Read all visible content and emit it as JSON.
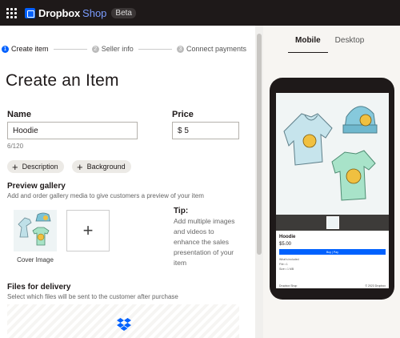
{
  "app": {
    "brand_name": "Dropbox",
    "brand_product": "Shop",
    "badge": "Beta"
  },
  "steps": [
    {
      "num": "1",
      "label": "Create item"
    },
    {
      "num": "2",
      "label": "Seller info"
    },
    {
      "num": "3",
      "label": "Connect payments"
    }
  ],
  "form": {
    "title": "Create an Item",
    "name_label": "Name",
    "name_value": "Hoodie",
    "name_counter": "6/120",
    "price_label": "Price",
    "price_value": "$ 5",
    "chip_description": "Description",
    "chip_background": "Background",
    "gallery_title": "Preview gallery",
    "gallery_sub": "Add and order gallery media to give customers a preview of your item",
    "cover_caption": "Cover Image",
    "add_symbol": "+",
    "tip_title": "Tip:",
    "tip_text": "Add multiple images and videos to enhance the sales presentation of your item",
    "files_title": "Files for delivery",
    "files_sub": "Select which files will be sent to the customer after purchase"
  },
  "preview": {
    "tab_mobile": "Mobile",
    "tab_desktop": "Desktop",
    "active_tab": "Mobile",
    "item_title": "Hoodie",
    "item_price": "$5.00",
    "buy_button": "Buy | Pay",
    "meta_1": "What's included",
    "meta_2": "File • 1",
    "meta_3": "Size • 1 MB",
    "footer_brand": "Dropbox Shop",
    "footer_right": "© 2023 Dropbox"
  },
  "colors": {
    "accent": "#0061fe",
    "topbar": "#1e1919",
    "phone": "#1e1919"
  }
}
